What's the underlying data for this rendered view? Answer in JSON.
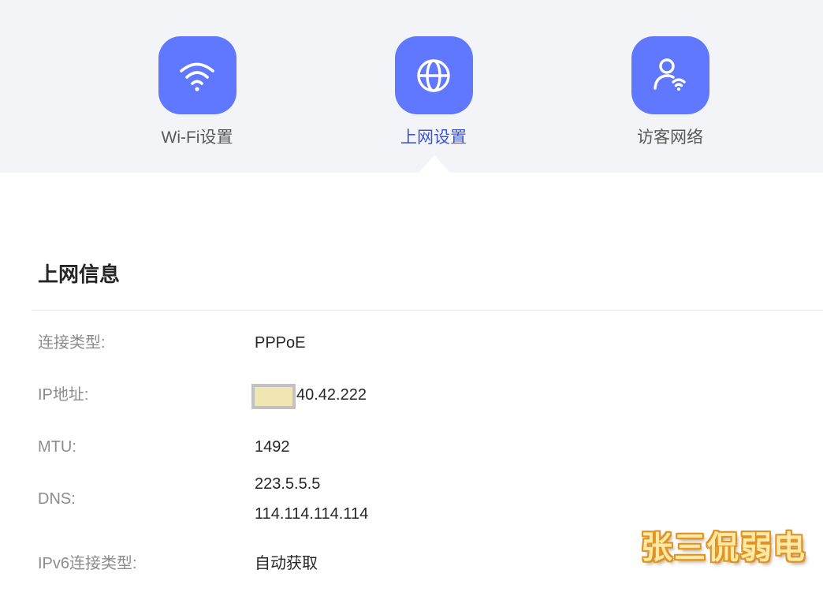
{
  "nav": {
    "items": [
      {
        "label": "Wi-Fi设置",
        "icon": "wifi-icon",
        "active": false
      },
      {
        "label": "上网设置",
        "icon": "globe-icon",
        "active": true
      },
      {
        "label": "访客网络",
        "icon": "guest-user-wifi-icon",
        "active": false
      }
    ],
    "accent_color": "#5f78ff",
    "active_label_color": "#3d56d8"
  },
  "section": {
    "title": "上网信息",
    "rows": [
      {
        "label": "连接类型:",
        "values": [
          "PPPoE"
        ]
      },
      {
        "label": "IP地址:",
        "values": [
          "40.42.222"
        ]
      },
      {
        "label": "MTU:",
        "values": [
          "1492"
        ]
      },
      {
        "label": "DNS:",
        "values": [
          "223.5.5.5",
          "114.114.114.114"
        ]
      },
      {
        "label": "IPv6连接类型:",
        "values": [
          "自动获取"
        ]
      }
    ]
  },
  "watermark": {
    "text": "张三侃弱电"
  }
}
